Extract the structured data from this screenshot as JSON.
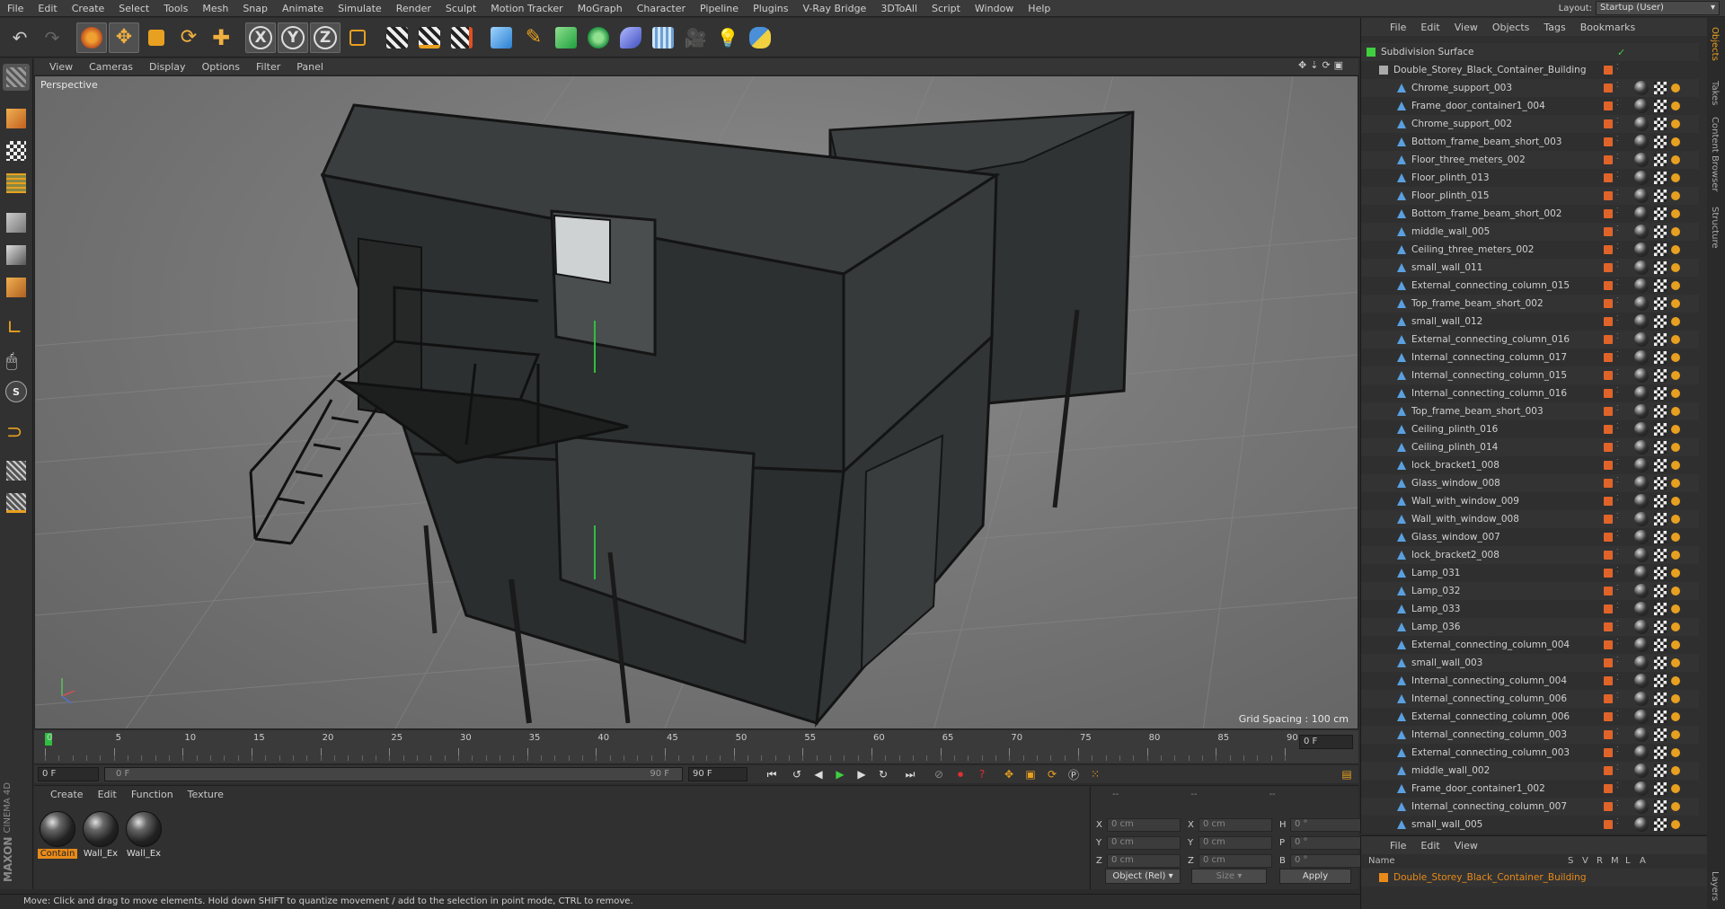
{
  "menu": [
    "File",
    "Edit",
    "Create",
    "Select",
    "Tools",
    "Mesh",
    "Snap",
    "Animate",
    "Simulate",
    "Render",
    "Sculpt",
    "Motion Tracker",
    "MoGraph",
    "Character",
    "Pipeline",
    "Plugins",
    "V-Ray Bridge",
    "3DToAll",
    "Script",
    "Window",
    "Help"
  ],
  "layout": {
    "label": "Layout:",
    "value": "Startup (User)"
  },
  "viewport": {
    "menu": [
      "View",
      "Cameras",
      "Display",
      "Options",
      "Filter",
      "Panel"
    ],
    "label": "Perspective",
    "grid_spacing": "Grid Spacing : 100 cm"
  },
  "timeline": {
    "ticks": [
      "0",
      "5",
      "10",
      "15",
      "20",
      "25",
      "30",
      "35",
      "40",
      "45",
      "50",
      "55",
      "60",
      "65",
      "70",
      "75",
      "80",
      "85",
      "90"
    ],
    "frame_field": "0 F",
    "start_field": "0 F",
    "range_start": "0 F",
    "range_end": "90 F",
    "end_field": "90 F"
  },
  "materials": {
    "menu": [
      "Create",
      "Edit",
      "Function",
      "Texture"
    ],
    "items": [
      {
        "label": "Contain",
        "selected": true
      },
      {
        "label": "Wall_Ex",
        "selected": false
      },
      {
        "label": "Wall_Ex",
        "selected": false
      }
    ]
  },
  "coords": {
    "header": [
      "--",
      "--",
      "--"
    ],
    "rows": [
      {
        "a": "X",
        "av": "0 cm",
        "b": "X",
        "bv": "0 cm",
        "c": "H",
        "cv": "0 °"
      },
      {
        "a": "Y",
        "av": "0 cm",
        "b": "Y",
        "bv": "0 cm",
        "c": "P",
        "cv": "0 °"
      },
      {
        "a": "Z",
        "av": "0 cm",
        "b": "Z",
        "bv": "0 cm",
        "c": "B",
        "cv": "0 °"
      }
    ],
    "mode": "Object (Rel)",
    "size": "Size",
    "apply": "Apply"
  },
  "status": "Move: Click and drag to move elements. Hold down SHIFT to quantize movement / add to the selection in point mode, CTRL to remove.",
  "objects": {
    "menu": [
      "File",
      "Edit",
      "View",
      "Objects",
      "Tags",
      "Bookmarks"
    ],
    "root": "Subdivision Surface",
    "group": "Double_Storey_Black_Container_Building",
    "children": [
      "Chrome_support_003",
      "Frame_door_container1_004",
      "Chrome_support_002",
      "Bottom_frame_beam_short_003",
      "Floor_three_meters_002",
      "Floor_plinth_013",
      "Floor_plinth_015",
      "Bottom_frame_beam_short_002",
      "middle_wall_005",
      "Ceiling_three_meters_002",
      "small_wall_011",
      "External_connecting_column_015",
      "Top_frame_beam_short_002",
      "small_wall_012",
      "External_connecting_column_016",
      "Internal_connecting_column_017",
      "Internal_connecting_column_015",
      "Internal_connecting_column_016",
      "Top_frame_beam_short_003",
      "Ceiling_plinth_016",
      "Ceiling_plinth_014",
      "lock_bracket1_008",
      "Glass_window_008",
      "Wall_with_window_009",
      "Wall_with_window_008",
      "Glass_window_007",
      "lock_bracket2_008",
      "Lamp_031",
      "Lamp_032",
      "Lamp_033",
      "Lamp_036",
      "External_connecting_column_004",
      "small_wall_003",
      "Internal_connecting_column_004",
      "Internal_connecting_column_006",
      "External_connecting_column_006",
      "Internal_connecting_column_003",
      "External_connecting_column_003",
      "middle_wall_002",
      "Frame_door_container1_002",
      "Internal_connecting_column_007",
      "small_wall_005"
    ]
  },
  "layers": {
    "menu": [
      "File",
      "Edit",
      "View"
    ],
    "columns": [
      "Name",
      "S",
      "V",
      "R",
      "M",
      "L",
      "A"
    ],
    "row": "Double_Storey_Black_Container_Building"
  },
  "side_tabs": [
    "Objects",
    "Takes",
    "Content Browser",
    "Structure",
    "Layers"
  ],
  "brand": [
    "MAXON",
    "CINEMA 4D"
  ],
  "colors": {
    "accent": "#e88a1a",
    "timeline_cursor": "#2fbf3f",
    "object_tag": "#e0642a"
  }
}
